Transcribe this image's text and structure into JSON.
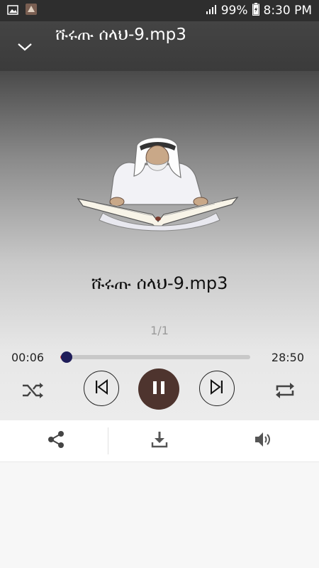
{
  "status_bar": {
    "battery": "99%",
    "time": "8:30 PM",
    "icons": [
      "image-notification-icon",
      "app-notification-icon",
      "signal-icon",
      "battery-charging-icon"
    ]
  },
  "header": {
    "title": "ሹሩጡ ሰላህ-9.mp3",
    "collapse_icon": "chevron-down-icon"
  },
  "player": {
    "song_title": "ሹሩጡ ሰላህ-9.mp3",
    "page_indicator": "1/1",
    "current_time": "00:06",
    "total_time": "28:50",
    "progress_fraction": 0.035,
    "artwork": "man-reading-book-illustration",
    "controls": [
      "shuffle-icon",
      "skip-previous-icon",
      "pause-icon",
      "skip-next-icon",
      "repeat-icon"
    ]
  },
  "bottom_bar": {
    "actions": [
      "share-icon",
      "download-icon",
      "volume-icon"
    ]
  },
  "colors": {
    "accent_red": "#e53935",
    "thumb": "#1f1d59",
    "pause_button": "#4e342e"
  }
}
